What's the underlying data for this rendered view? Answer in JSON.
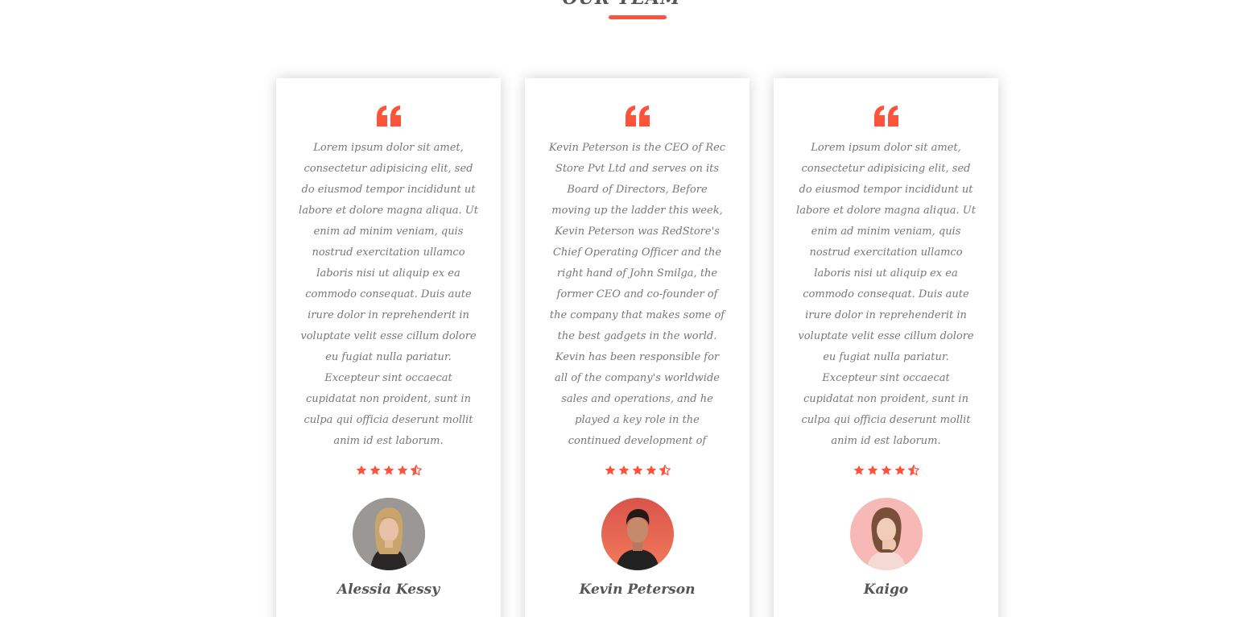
{
  "section": {
    "title": "OUR TEAM",
    "accent_color": "#ff523b"
  },
  "testimonials": [
    {
      "text": "Lorem ipsum dolor sit amet, consectetur adipisicing elit, sed do eiusmod tempor incididunt ut labore et dolore magna aliqua. Ut enim ad minim veniam, quis nostrud exercitation ullamco laboris nisi ut aliquip ex ea commodo consequat. Duis aute irure dolor in reprehenderit in voluptate velit esse cillum dolore eu fugiat nulla pariatur. Excepteur sint occaecat cupidatat non proident, sunt in culpa qui officia deserunt mollit anim id est laborum.",
      "rating": 4.5,
      "name": "Alessia Kessy",
      "avatar_icon": "woman-portrait-avatar"
    },
    {
      "text": "Kevin Peterson is the CEO of Rec Store Pvt Ltd and serves on its Board of Directors, Before moving up the ladder this week, Kevin Peterson was RedStore's Chief Operating Officer and the right hand of John Smilga, the former CEO and co-founder of the company that makes some of the best gadgets in the world. Kevin has been responsible for all of the company's worldwide sales and operations, and he played a key role in the continued development of strategic relationships.",
      "rating": 4.5,
      "name": "Kevin Peterson",
      "avatar_icon": "man-portrait-avatar"
    },
    {
      "text": "Lorem ipsum dolor sit amet, consectetur adipisicing elit, sed do eiusmod tempor incididunt ut labore et dolore magna aliqua. Ut enim ad minim veniam, quis nostrud exercitation ullamco laboris nisi ut aliquip ex ea commodo consequat. Duis aute irure dolor in reprehenderit in voluptate velit esse cillum dolore eu fugiat nulla pariatur. Excepteur sint occaecat cupidatat non proident, sunt in culpa qui officia deserunt mollit anim id est laborum.",
      "rating": 4.5,
      "name": "Kaigo",
      "avatar_icon": "woman-portrait-avatar"
    }
  ]
}
